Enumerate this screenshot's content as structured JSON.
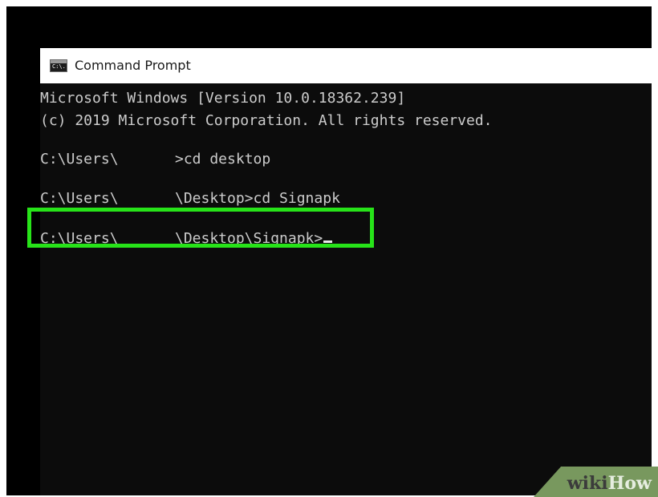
{
  "window": {
    "title": "Command Prompt",
    "icon_label": "C:\\.",
    "icon": "cmd-icon"
  },
  "terminal": {
    "lines": [
      {
        "text": "Microsoft Windows [Version 10.0.18362.239]"
      },
      {
        "text": "(c) 2019 Microsoft Corporation. All rights reserved."
      },
      {
        "user_prefix": "C:\\Users\\",
        "rest": ">cd desktop"
      },
      {
        "user_prefix": "C:\\Users\\",
        "rest": "\\Desktop>cd Signapk"
      },
      {
        "user_prefix": "C:\\Users\\",
        "rest": "\\Desktop\\Signapk>"
      }
    ]
  },
  "colors": {
    "terminal_background": "#0c0c0c",
    "terminal_text": "#cccccc",
    "highlight_border": "#27e319",
    "watermark_background": "#78985e"
  },
  "watermark": {
    "wiki": "wiki",
    "how": "How"
  }
}
